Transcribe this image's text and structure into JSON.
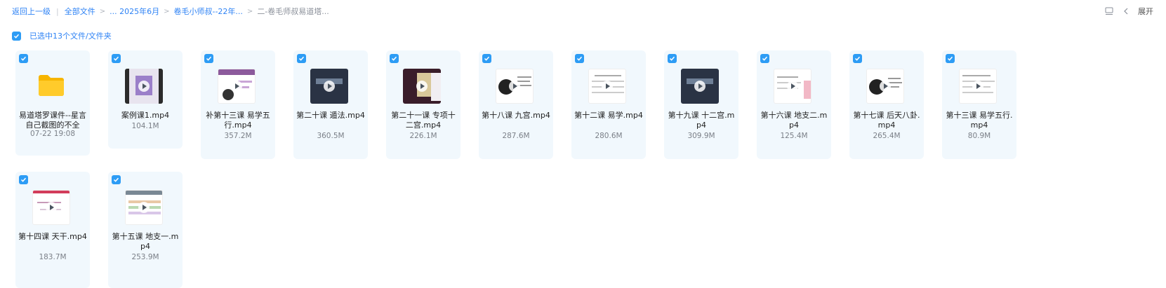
{
  "breadcrumb": {
    "back": "返回上一级",
    "all_files": "全部文件",
    "path1": "... 2025年6月",
    "path2": "卷毛小师叔--22年...",
    "current": "二-卷毛师叔易道塔..."
  },
  "tools": {
    "expand_label": "展开"
  },
  "selection": {
    "text": "已选中13个文件/文件夹"
  },
  "files": [
    {
      "name": "易道塔罗课件--星言自己截图的不全",
      "meta": "07-22 19:08",
      "kind": "folder"
    },
    {
      "name": "案例课1.mp4",
      "meta": "104.1M",
      "kind": "video"
    },
    {
      "name": "补第十三课 易学五行.mp4",
      "meta": "357.2M",
      "kind": "video"
    },
    {
      "name": "第二十课 遁法.mp4",
      "meta": "360.5M",
      "kind": "video"
    },
    {
      "name": "第二十一课 专项十二宫.mp4",
      "meta": "226.1M",
      "kind": "video"
    },
    {
      "name": "第十八课 九宫.mp4",
      "meta": "287.6M",
      "kind": "video"
    },
    {
      "name": "第十二课 易学.mp4",
      "meta": "280.6M",
      "kind": "video"
    },
    {
      "name": "第十九课 十二宫.mp4",
      "meta": "309.9M",
      "kind": "video"
    },
    {
      "name": "第十六课 地支二.mp4",
      "meta": "125.4M",
      "kind": "video"
    },
    {
      "name": "第十七课 后天八卦.mp4",
      "meta": "265.4M",
      "kind": "video"
    },
    {
      "name": "第十三课 易学五行.mp4",
      "meta": "80.9M",
      "kind": "video"
    },
    {
      "name": "第十四课 天干.mp4",
      "meta": "183.7M",
      "kind": "video"
    },
    {
      "name": "第十五课 地支一.mp4",
      "meta": "253.9M",
      "kind": "video"
    }
  ],
  "colors": {
    "accent": "#2d82f5",
    "check": "#2d9cf5",
    "card_bg": "#f1f8fd"
  }
}
